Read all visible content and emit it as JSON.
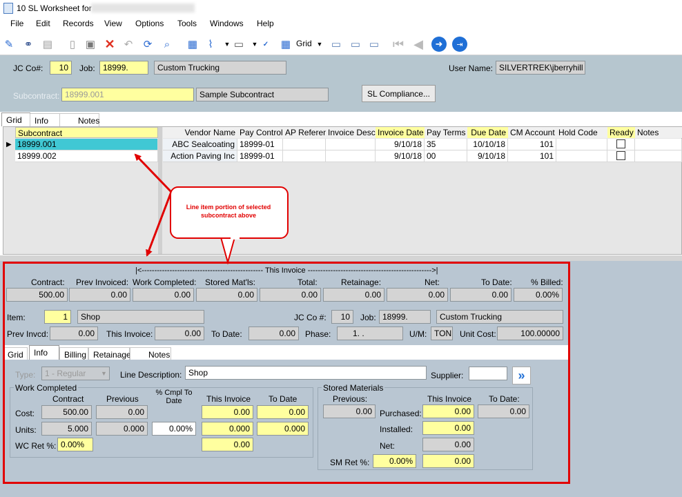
{
  "window": {
    "title": "10 SL Worksheet for"
  },
  "menu": [
    "File",
    "Edit",
    "Records",
    "View",
    "Options",
    "Tools",
    "Windows",
    "Help"
  ],
  "toolbar": {
    "grid_label": "Grid"
  },
  "header": {
    "jc_co_label": "JC Co#:",
    "jc_co": "10",
    "job_label": "Job:",
    "job": "18999.",
    "job_desc": "Custom Trucking",
    "user_label": "User Name:",
    "user": "SILVERTREK\\jberryhill",
    "subcontract_label": "Subcontract:",
    "subcontract": "18999.001",
    "subcontract_desc": "Sample Subcontract",
    "compliance_button": "SL Compliance..."
  },
  "tabs_top": [
    "Grid",
    "Info",
    "Notes"
  ],
  "subcontract_grid": {
    "header": "Subcontract",
    "rows": [
      "18999.001",
      "18999.002"
    ]
  },
  "line_grid": {
    "columns": [
      "Vendor Name",
      "Pay Control",
      "AP Referenc",
      "Invoice Desc",
      "Invoice Date",
      "Pay Terms",
      "Due Date",
      "CM Account",
      "Hold Code",
      "Ready",
      "Notes"
    ],
    "rows": [
      {
        "vendor": "ABC Sealcoating",
        "pay_control": "18999-01",
        "ap_ref": "",
        "inv_desc": "",
        "inv_date": "9/10/18",
        "pay_terms": "35",
        "due_date": "10/10/18",
        "cm_account": "101",
        "hold": "",
        "notes": ""
      },
      {
        "vendor": "Action Paving Inc",
        "pay_control": "18999-01",
        "ap_ref": "",
        "inv_desc": "",
        "inv_date": "9/10/18",
        "pay_terms": "00",
        "due_date": "9/10/18",
        "cm_account": "101",
        "hold": "",
        "notes": ""
      }
    ]
  },
  "callout": {
    "text": "Line item portion of selected subcontract above"
  },
  "this_invoice_banner": "|<------------------------------------------------ This Invoice ------------------------------------------------->|",
  "totals": {
    "labels": [
      "Contract:",
      "Prev Invoiced:",
      "Work Completed:",
      "Stored Mat'ls:",
      "Total:",
      "Retainage:",
      "Net:",
      "To Date:",
      "% Billed:"
    ],
    "values": [
      "500.00",
      "0.00",
      "0.00",
      "0.00",
      "0.00",
      "0.00",
      "0.00",
      "0.00",
      "0.00%"
    ]
  },
  "item": {
    "item_label": "Item:",
    "item": "1",
    "item_desc": "Shop",
    "jc_co_label": "JC Co #:",
    "jc_co": "10",
    "job_label": "Job:",
    "job": "18999.",
    "job_desc": "Custom Trucking",
    "prev_invcd_label": "Prev Invcd:",
    "prev_invcd": "0.00",
    "this_invoice_label": "This Invoice:",
    "this_invoice": "0.00",
    "to_date_label": "To Date:",
    "to_date": "0.00",
    "phase_label": "Phase:",
    "phase": "1.   .",
    "um_label": "U/M:",
    "um": "TON",
    "unit_cost_label": "Unit Cost:",
    "unit_cost": "100.00000"
  },
  "tabs_bottom": [
    "Grid",
    "Info",
    "Billing",
    "Retainage",
    "Notes"
  ],
  "info": {
    "type_label": "Type:",
    "type": "1 - Regular",
    "line_desc_label": "Line Description:",
    "line_desc": "Shop",
    "supplier_label": "Supplier:",
    "supplier": "",
    "wc_title": "Work Completed",
    "wc_cols": [
      "Contract",
      "Previous",
      "% Cmpl To Date",
      "This Invoice",
      "To Date"
    ],
    "cost_label": "Cost:",
    "cost_contract": "500.00",
    "cost_previous": "0.00",
    "cost_this": "0.00",
    "cost_todate": "0.00",
    "units_label": "Units:",
    "units_contract": "5.000",
    "units_previous": "0.000",
    "units_pct": "0.00%",
    "units_this": "0.000",
    "units_todate": "0.000",
    "wc_ret_label": "WC Ret %:",
    "wc_ret": "0.00%",
    "wc_ret_amt": "0.00",
    "sm_title": "Stored Materials",
    "sm_previous_label": "Previous:",
    "sm_this_label": "This Invoice",
    "sm_todate_label": "To Date:",
    "sm_previous": "0.00",
    "purchased_label": "Purchased:",
    "purchased": "0.00",
    "sm_todate": "0.00",
    "installed_label": "Installed:",
    "installed": "0.00",
    "net_label": "Net:",
    "net": "0.00",
    "sm_ret_label": "SM Ret %:",
    "sm_ret": "0.00%",
    "sm_ret_amt": "0.00"
  }
}
